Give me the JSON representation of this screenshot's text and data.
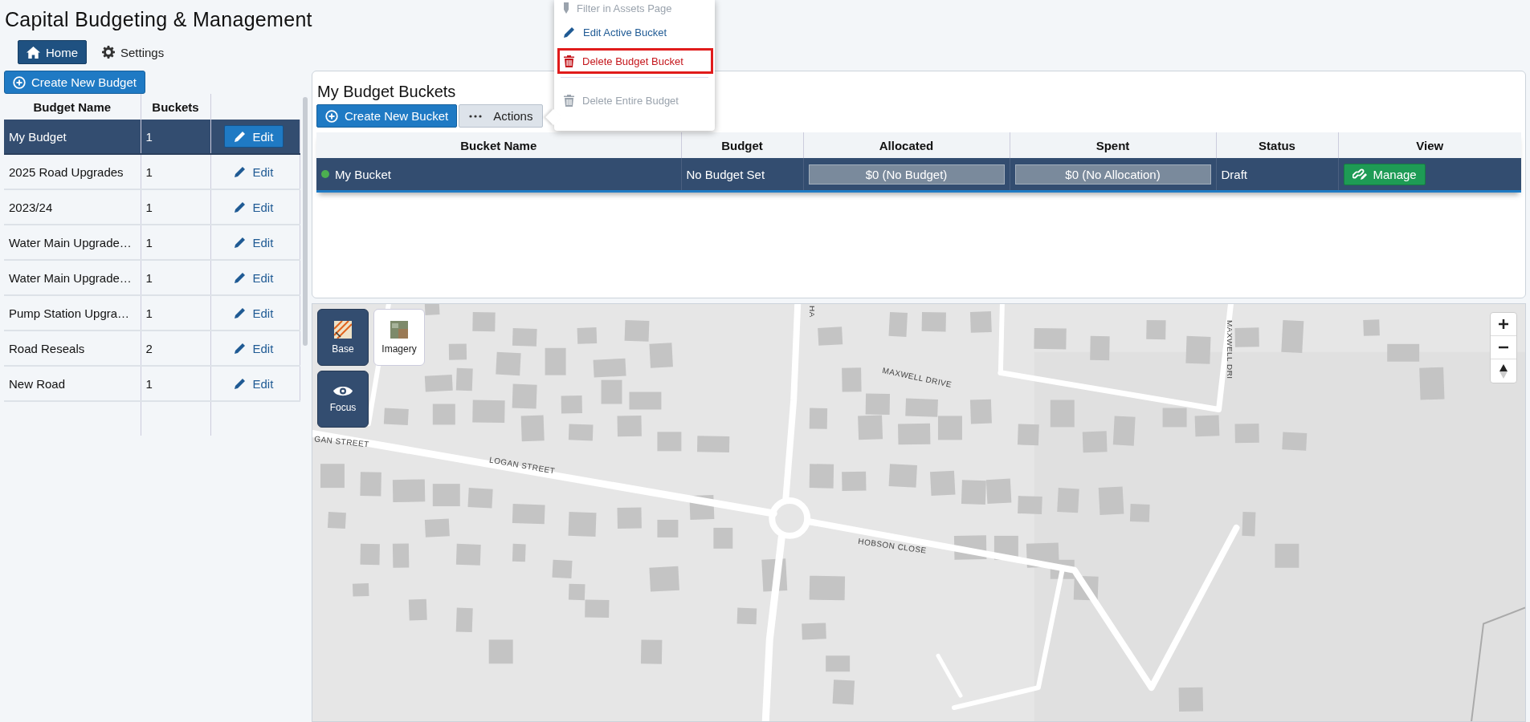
{
  "app": {
    "title": "Capital Budgeting & Management"
  },
  "nav": [
    {
      "label": "Home",
      "selected": true
    },
    {
      "label": "Settings",
      "selected": false
    }
  ],
  "budgets": {
    "create_button": "Create New Budget",
    "columns": [
      "Budget Name",
      "Buckets"
    ],
    "rows": [
      {
        "name": "My Budget",
        "buckets": "1",
        "action": "Edit",
        "selected": true
      },
      {
        "name": "2025 Road Upgrades",
        "buckets": "1",
        "action": "Edit",
        "selected": false
      },
      {
        "name": "2023/24",
        "buckets": "1",
        "action": "Edit",
        "selected": false
      },
      {
        "name": "Water Main Upgrade…",
        "buckets": "1",
        "action": "Edit",
        "selected": false
      },
      {
        "name": "Water Main Upgrade…",
        "buckets": "1",
        "action": "Edit",
        "selected": false
      },
      {
        "name": "Pump Station Upgra…",
        "buckets": "1",
        "action": "Edit",
        "selected": false
      },
      {
        "name": "Road Reseals",
        "buckets": "2",
        "action": "Edit",
        "selected": false
      },
      {
        "name": "New Road",
        "buckets": "1",
        "action": "Edit",
        "selected": false
      }
    ]
  },
  "buckets_panel": {
    "title": "My Budget Buckets",
    "create_button": "Create New Bucket",
    "actions_button": "Actions",
    "columns": [
      "Bucket Name",
      "Budget",
      "Allocated",
      "Spent",
      "Status",
      "View"
    ],
    "rows": [
      {
        "name": "My Bucket",
        "color": "#4caf50",
        "budget": "No Budget Set",
        "allocated": "$0 (No Budget)",
        "spent": "$0 (No Allocation)",
        "status": "Draft",
        "action": "Manage",
        "selected": true
      }
    ]
  },
  "actions_menu": {
    "items": [
      {
        "kind": "filter",
        "label": "Filter in Assets Page",
        "disabled": true,
        "highlighted": false
      },
      {
        "kind": "edit",
        "label": "Edit Active Bucket",
        "disabled": false,
        "highlighted": false
      },
      {
        "kind": "delete",
        "label": "Delete Budget Bucket",
        "disabled": false,
        "highlighted": true
      },
      {
        "kind": "delete",
        "label": "Delete Entire Budget",
        "disabled": true,
        "highlighted": false
      }
    ]
  },
  "map": {
    "layers": [
      {
        "kind": "base",
        "label": "Base",
        "selected": true
      },
      {
        "kind": "imagery",
        "label": "Imagery",
        "selected": false
      }
    ],
    "focus": {
      "label": "Focus",
      "on": true
    },
    "street_labels": [
      "GAN STREET",
      "LOGAN STREET",
      "HOBSON CLOSE",
      "MAXWELL DRIVE",
      "MAXWELL DRI",
      "HA"
    ]
  }
}
